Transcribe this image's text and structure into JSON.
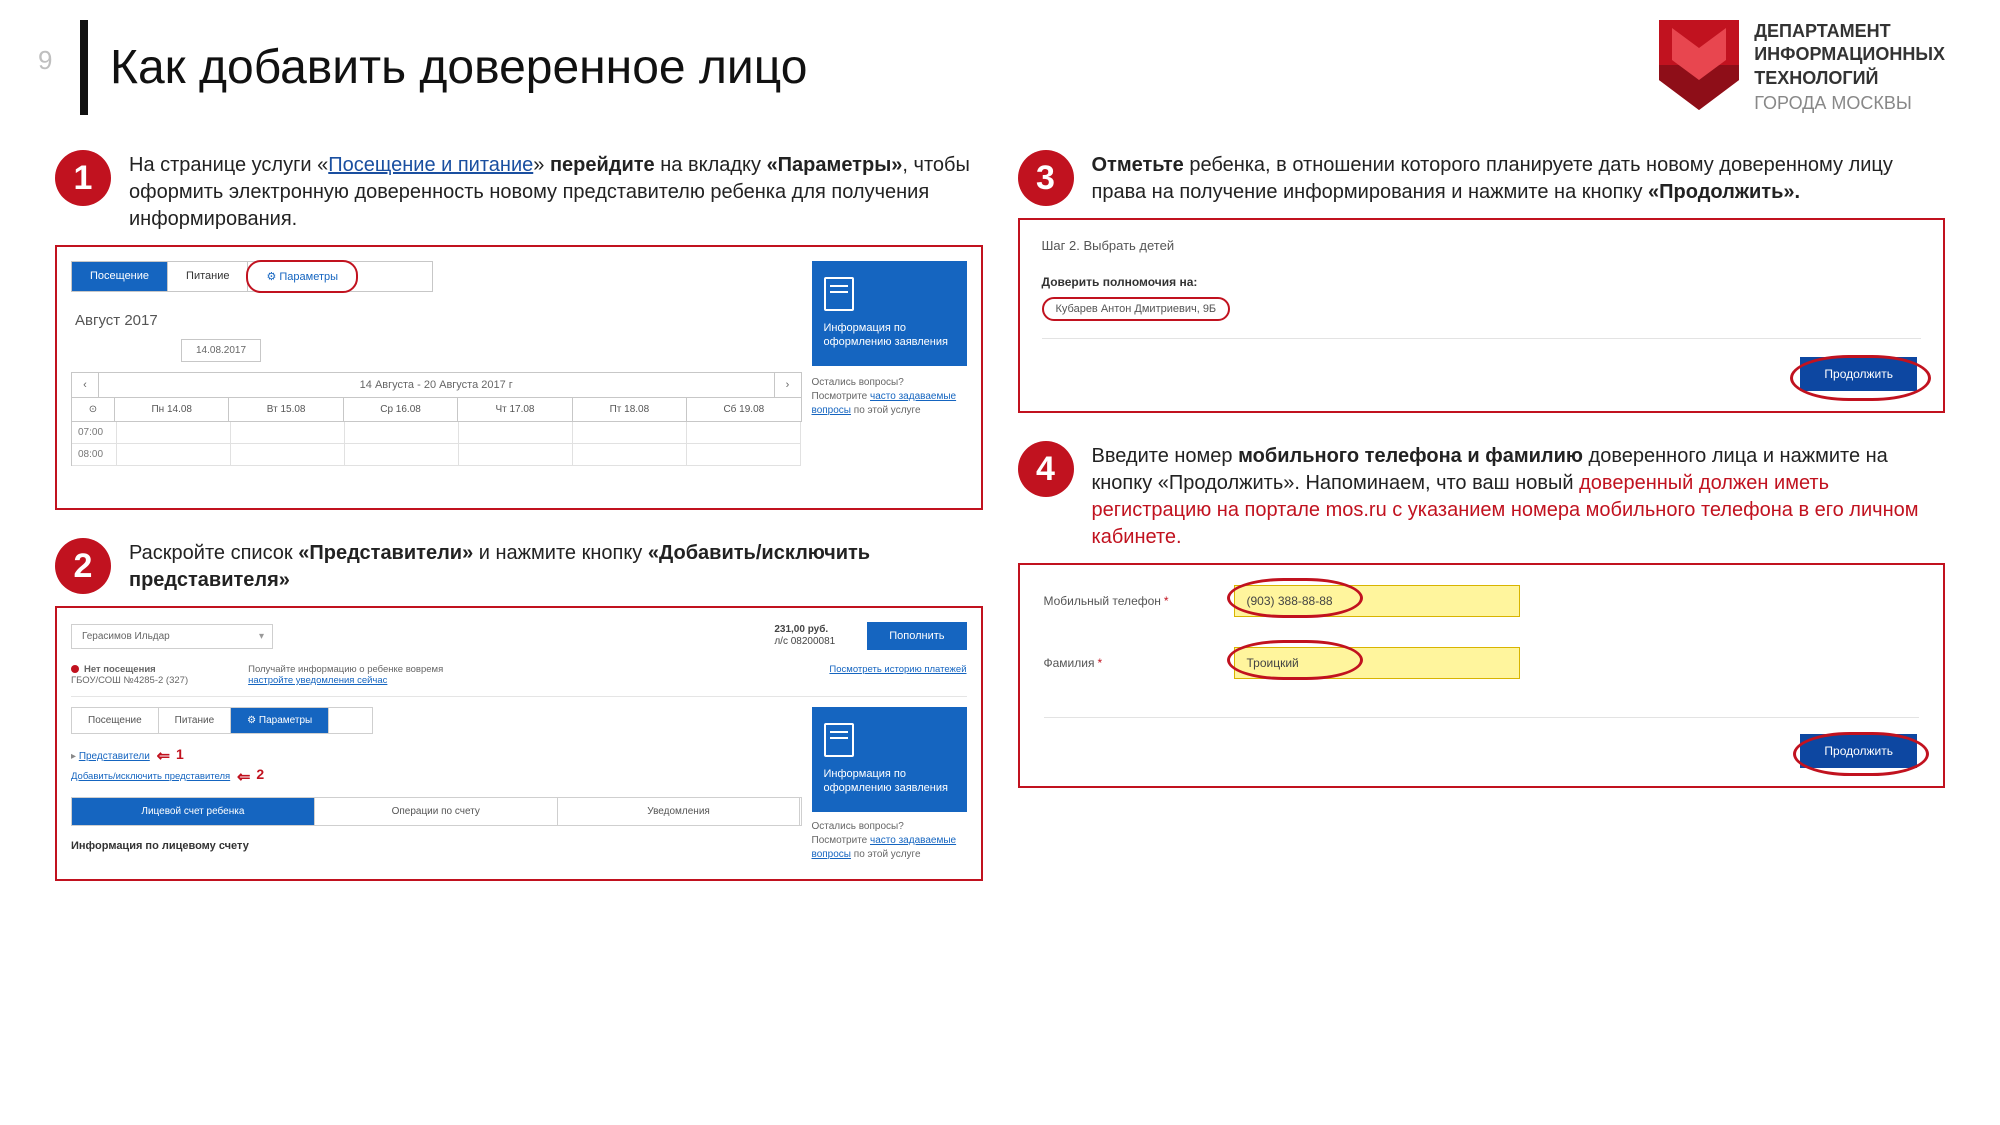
{
  "page_number": "9",
  "title": "Как добавить доверенное лицо",
  "logo": {
    "l1": "ДЕПАРТАМЕНТ",
    "l2": "ИНФОРМАЦИОННЫХ",
    "l3": "ТЕХНОЛОГИЙ",
    "l4": "ГОРОДА МОСКВЫ"
  },
  "step1": {
    "n": "1",
    "pre": "На странице услуги «",
    "link": "Посещение и питание",
    "post": "» ",
    "b1": "перейдите",
    "mid1": " на вкладку ",
    "b2": "«Параметры»",
    "tail": ", чтобы оформить электронную доверенность новому представителю ребенка для получения информирования."
  },
  "shot1": {
    "tab1": "Посещение",
    "tab2": "Питание",
    "tab3": "⚙ Параметры",
    "month": "Август 2017",
    "date": "14.08.2017",
    "range": "14 Августа - 20 Августа 2017 г",
    "d0": "⊙",
    "d1": "Пн 14.08",
    "d2": "Вт 15.08",
    "d3": "Ср 16.08",
    "d4": "Чт 17.08",
    "d5": "Пт 18.08",
    "d6": "Сб 19.08",
    "t1": "07:00",
    "t2": "08:00",
    "card": "Информация по оформлению заявления",
    "faq1": "Остались вопросы?",
    "faq2": "Посмотрите ",
    "faqlink": "часто задаваемые вопросы",
    "faq3": " по этой услуге"
  },
  "step2": {
    "n": "2",
    "pre": "Раскройте список ",
    "b1": "«Представители»",
    "mid": " и нажмите кнопку ",
    "b2": "«Добавить/исключить представителя»"
  },
  "shot2": {
    "child": "Герасимов Ильдар",
    "bal1": "231,00 руб.",
    "bal2": "л/с 08200081",
    "btn": "Пополнить",
    "st1": "Нет посещения",
    "st2": "ГБОУ/СОШ №4285-2 (327)",
    "inf1": "Получайте информацию о ребенке вовремя",
    "inf2": "настройте уведомления сейчас",
    "hist": "Посмотреть историю платежей",
    "tab1": "Посещение",
    "tab2": "Питание",
    "tab3": "⚙ Параметры",
    "rep": "Представители",
    "add": "Добавить/исключить представителя",
    "n1": "1",
    "n2": "2",
    "bt1": "Лицевой счет ребенка",
    "bt2": "Операции по счету",
    "bt3": "Уведомления",
    "acc": "Информация по лицевому счету",
    "card": "Информация по оформлению заявления",
    "faq1": "Остались вопросы?",
    "faq2": "Посмотрите ",
    "faqlink": "часто задаваемые вопросы",
    "faq3": " по этой услуге"
  },
  "step3": {
    "n": "3",
    "b1": "Отметьте",
    "mid": " ребенка, в отношении которого планируете дать новому доверенному лицу права на получение информирования и нажмите на кнопку ",
    "b2": "«Продолжить»."
  },
  "shot3": {
    "stepname": "Шаг 2. Выбрать детей",
    "lbl": "Доверить полномочия на:",
    "child": "Кубарев Антон Дмитриевич, 9Б",
    "btn": "Продолжить"
  },
  "step4": {
    "n": "4",
    "pre": "Введите номер ",
    "b1": "мобильного телефона и фамилию",
    "mid": " доверенного лица и нажмите на кнопку «Продолжить». Напоминаем, что ваш новый ",
    "red": "доверенный должен иметь регистрацию на портале mos.ru с указанием номера мобильного телефона в его личном кабинете."
  },
  "shot4": {
    "l1": "Мобильный телефон",
    "l2": "Фамилия",
    "ast": "*",
    "v1": "(903) 388-88-88",
    "v2": "Троицкий",
    "btn": "Продолжить"
  }
}
